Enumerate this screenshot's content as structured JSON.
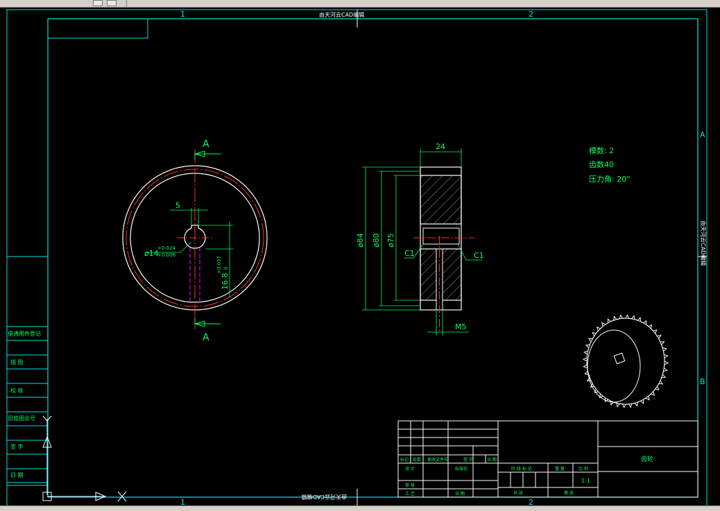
{
  "app": {
    "toolbar_icons": [
      "cursor-icon",
      "window-icon"
    ]
  },
  "border": {
    "zone_top_1": "1",
    "zone_top_2": "2",
    "zone_bottom_1": "1",
    "zone_bottom_2": "2",
    "zone_right_a": "A",
    "zone_right_b": "B",
    "watermark_top": "由天河云CAD编辑",
    "watermark_bottom": "由天河云CAD编辑",
    "watermark_right": "由天河云CAD编辑"
  },
  "front_view": {
    "section_label_top": "A",
    "section_label_bottom": "A",
    "dim_keyway_width": "5",
    "dim_bore": "ø14",
    "dim_bore_tol_upper": "+0.024",
    "dim_bore_tol_lower": "+0.006",
    "dim_keyway_depth": "16.8",
    "dim_keyway_tol_upper": "+0.037",
    "dim_keyway_tol_lower": "0"
  },
  "section_view": {
    "dim_width": "24",
    "dim_outer": "ø84",
    "dim_pitch": "ø80",
    "dim_root": "ø75",
    "chamfer_left": "C1",
    "chamfer_right": "C1",
    "dim_thread": "M5"
  },
  "gear_params": {
    "module": "模数: 2",
    "teeth": "齿数40",
    "pressure_angle": "压力角: 20°"
  },
  "side_table": {
    "rows": [
      "借通用件登记",
      "描 图",
      "校 核",
      "旧底图总号",
      "签 字",
      "日 期"
    ]
  },
  "title_block": {
    "part_name": "齿轮",
    "scale": "1:1",
    "header_cells": [
      "标记",
      "处数",
      "更改文件号",
      "签 字",
      "日 期"
    ],
    "left_labels": [
      "设 计",
      "标准化",
      "审 核",
      "工 艺",
      "日 期"
    ],
    "mid_labels": [
      "阶 段 标 记",
      "重 量",
      "比 例",
      "共 张",
      "第 张"
    ]
  },
  "colors": {
    "frame": "#00e5e5",
    "geometry": "#ffffff",
    "dimension": "#00ff66",
    "centerline": "#ff3030",
    "hidden": "#ff00ff",
    "background": "#000000"
  }
}
